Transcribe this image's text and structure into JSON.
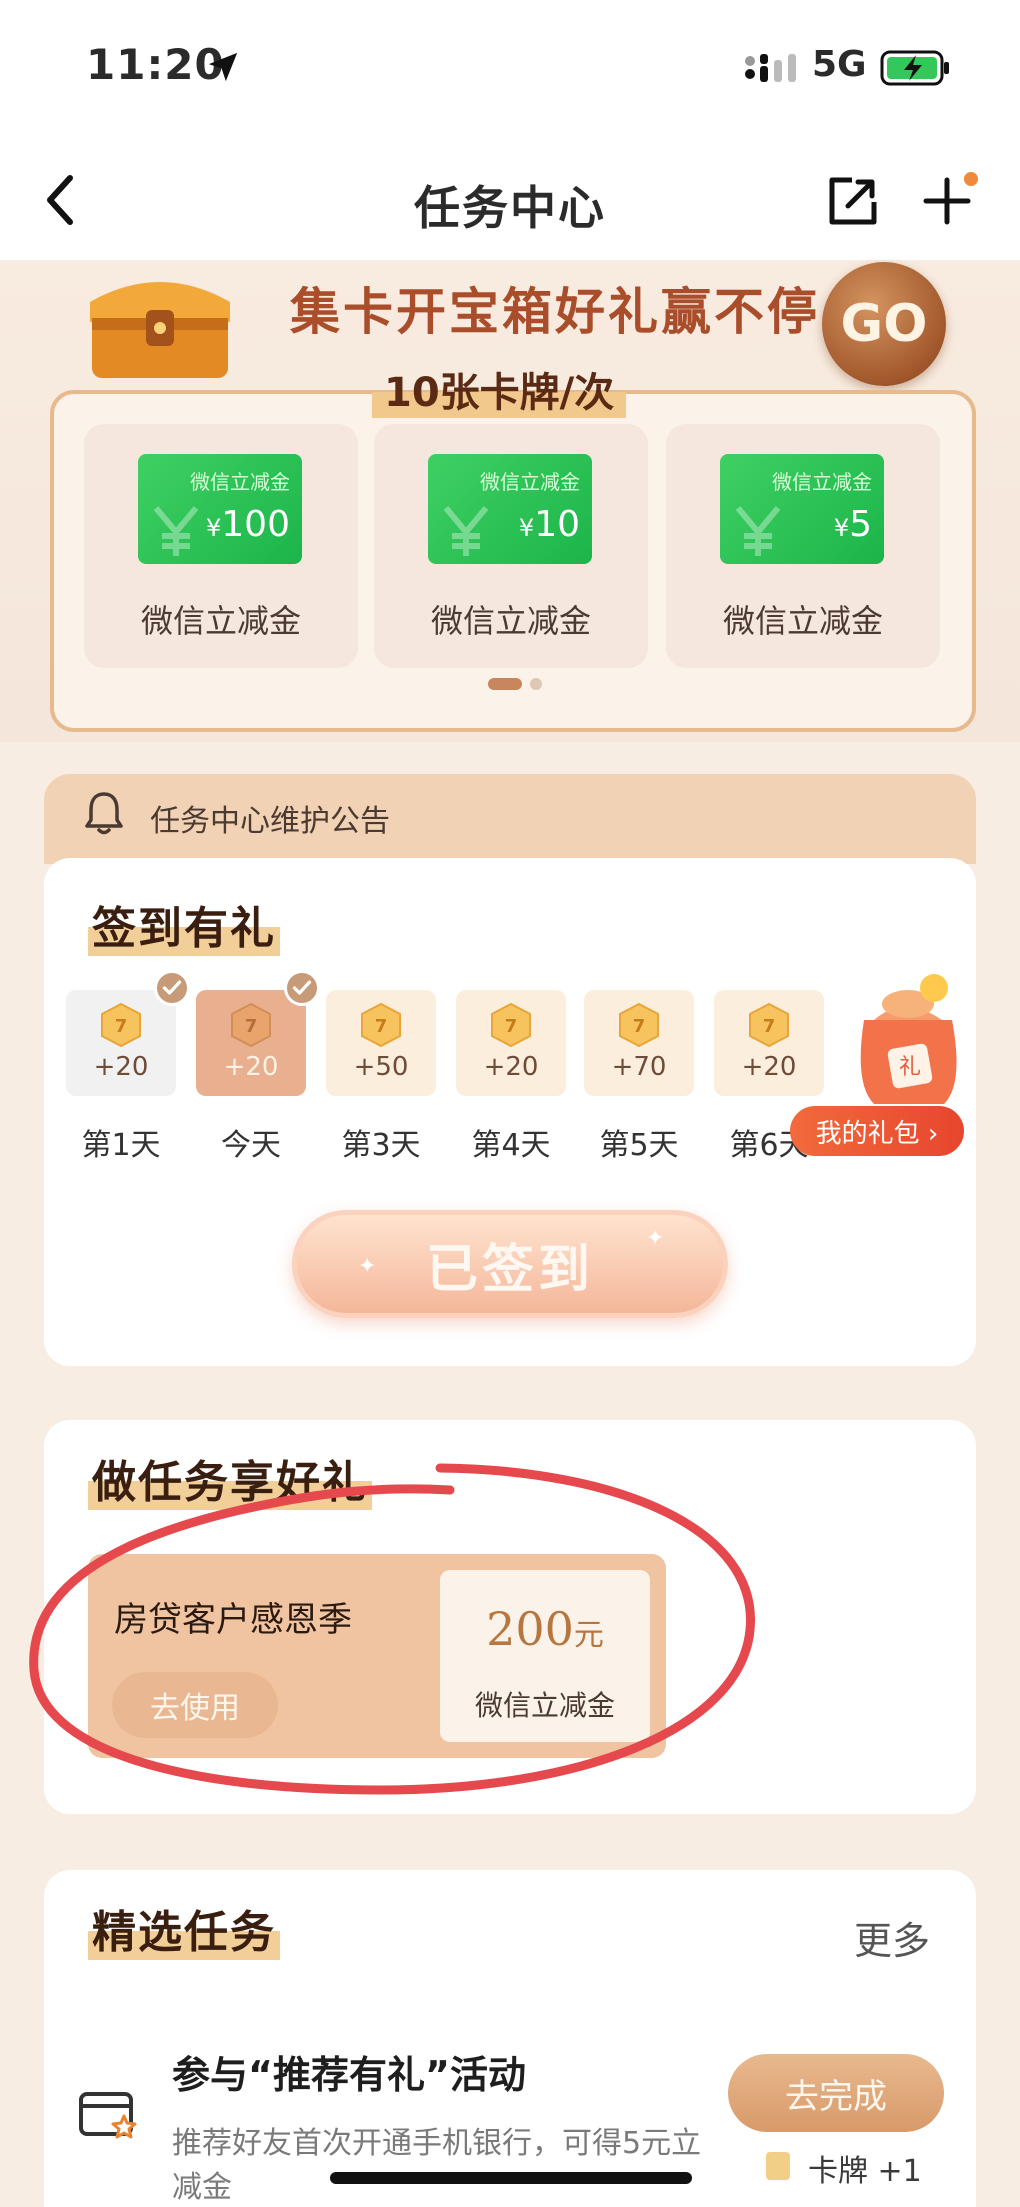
{
  "status_bar": {
    "time": "11:20",
    "network": "5G"
  },
  "nav": {
    "title": "任务中心"
  },
  "banner": {
    "title": "集卡开宝箱好礼赢不停",
    "subtitle": "10张卡牌/次",
    "go_label": "GO",
    "cards": [
      {
        "voucher_title": "微信立减金",
        "currency": "¥",
        "amount": "100",
        "label": "微信立减金"
      },
      {
        "voucher_title": "微信立减金",
        "currency": "¥",
        "amount": "10",
        "label": "微信立减金"
      },
      {
        "voucher_title": "微信立减金",
        "currency": "¥",
        "amount": "5",
        "label": "微信立减金"
      }
    ]
  },
  "notice": {
    "text": "任务中心维护公告"
  },
  "checkin": {
    "title": "签到有礼",
    "days": [
      {
        "points": "+20",
        "label": "第1天"
      },
      {
        "points": "+20",
        "label": "今天"
      },
      {
        "points": "+50",
        "label": "第3天"
      },
      {
        "points": "+20",
        "label": "第4天"
      },
      {
        "points": "+70",
        "label": "第5天"
      },
      {
        "points": "+20",
        "label": "第6天"
      }
    ],
    "gift_label": "我的礼包 ›",
    "signed_label": "已签到"
  },
  "task_rewards": {
    "title": "做任务享好礼",
    "coupon_name": "房贷客户感恩季",
    "use_label": "去使用",
    "amount": "200",
    "unit": "元",
    "desc": "微信立减金"
  },
  "selected": {
    "title": "精选任务",
    "more": "更多",
    "task": {
      "name": "参与“推荐有礼”活动",
      "desc": "推荐好友首次开通手机银行，可得5元立减金",
      "button": "去完成",
      "reward": "卡牌 +1"
    }
  },
  "colors": {
    "accent": "#c8865d",
    "brand_green": "#1cb54a",
    "highlight": "#f2cf98",
    "mark_red": "#e5484d"
  }
}
